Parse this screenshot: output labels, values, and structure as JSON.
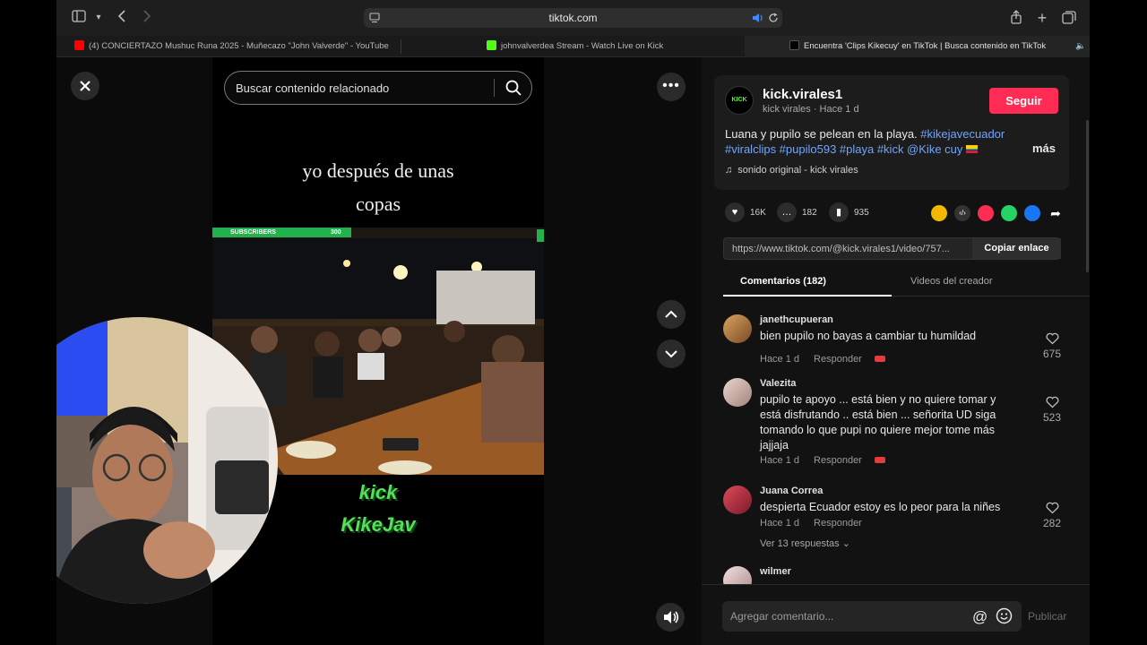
{
  "browser": {
    "url": "tiktok.com",
    "tabs": [
      {
        "title": "(4) CONCIERTAZO Mushuc Runa 2025 - Muñecazo \"John Valverde\" - YouTube"
      },
      {
        "title": "johnvalverdea Stream - Watch Live on Kick"
      },
      {
        "title": "Encuentra 'Clips Kikecuy' en TikTok | Busca contenido en TikTok"
      }
    ]
  },
  "video": {
    "search_placeholder": "Buscar contenido relacionado",
    "caption_line1": "yo después de unas",
    "caption_line2": "copas",
    "subscribers_label": "SUBSCRIBERS",
    "subscribers_count": "300",
    "overlay_line1": "kick",
    "overlay_line2": "KikeJav"
  },
  "post": {
    "avatar_text": "KICK",
    "username": "kick.virales1",
    "meta": "kick virales · Hace 1 d",
    "follow_label": "Seguir",
    "description": "Luana y pupilo se pelean en la playa.",
    "hashtags_line1": "#kikejavecuador",
    "hashtags_line2": "#viralclips #pupilo593 #playa #kick @Kike cuy",
    "more_label": "más",
    "sound": "sonido original - kick virales",
    "likes": "16K",
    "comments": "182",
    "saves": "935",
    "link": "https://www.tiktok.com/@kick.virales1/video/757...",
    "copy_label": "Copiar enlace"
  },
  "tabs": {
    "comments_label": "Comentarios (182)",
    "creator_label": "Videos del creador"
  },
  "comments": [
    {
      "user": "janethcupueran",
      "text": "bien pupilo no bayas a cambiar tu humildad",
      "time": "Hace 1 d",
      "reply": "Responder",
      "likes": "675"
    },
    {
      "user": "Valezita",
      "text": "pupilo te apoyo ... está bien y no quiere tomar y está disfrutando .. está bien ... señorita UD siga tomando lo que pupi no quiere mejor tome más jajjaja",
      "time": "Hace 1 d",
      "reply": "Responder",
      "likes": "523"
    },
    {
      "user": "Juana Correa",
      "text": "despierta Ecuador estoy es lo peor para la niñes",
      "time": "Hace 1 d",
      "reply": "Responder",
      "likes": "282",
      "more_replies": "Ver 13 respuestas"
    },
    {
      "user": "wilmer"
    }
  ],
  "comment_bar": {
    "placeholder": "Agregar comentario...",
    "publish_label": "Publicar"
  },
  "colors": {
    "accent": "#fe2c55",
    "hashtag": "#6ea6ff",
    "kick_green": "#53fc18"
  }
}
